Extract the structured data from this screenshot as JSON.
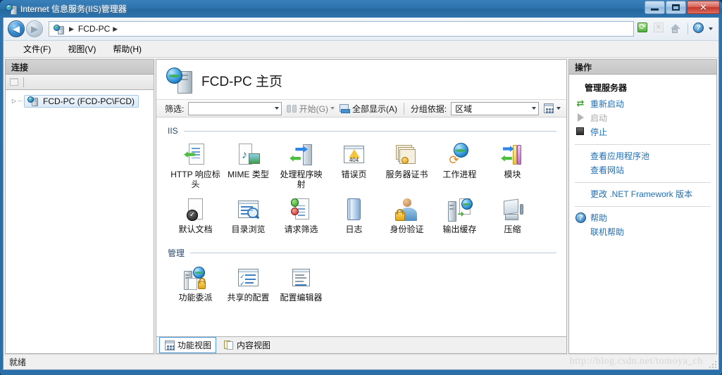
{
  "window": {
    "title": "Internet 信息服务(IIS)管理器",
    "buttons": {
      "minimize": "—",
      "maximize": "❐",
      "close": "✕"
    }
  },
  "nav": {
    "back_glyph": "◀",
    "forward_glyph": "▶",
    "breadcrumb": [
      "FCD-PC"
    ],
    "separator": "▶",
    "tools": [
      {
        "name": "refresh-icon",
        "tooltip": "刷新"
      },
      {
        "name": "stop-icon",
        "tooltip": "停止"
      },
      {
        "name": "home-icon",
        "tooltip": "主页"
      },
      {
        "name": "help-icon",
        "tooltip": "帮助"
      }
    ]
  },
  "menubar": {
    "items": [
      "文件(F)",
      "视图(V)",
      "帮助(H)"
    ]
  },
  "sidebar": {
    "title": "连接",
    "tree": [
      {
        "label": "FCD-PC (FCD-PC\\FCD)",
        "expander": "▷",
        "selected": true
      }
    ]
  },
  "main": {
    "page_title": "FCD-PC 主页",
    "filter": {
      "label": "筛选:",
      "value": "",
      "go_label": "开始(G)",
      "show_all_label": "全部显示(A)",
      "group_by_label": "分组依据:",
      "group_by_value": "区域"
    },
    "sections": [
      {
        "title": "IIS",
        "items": [
          {
            "label": "HTTP 响应标头",
            "icon": "http-response-headers-icon"
          },
          {
            "label": "MIME 类型",
            "icon": "mime-types-icon"
          },
          {
            "label": "处理程序映射",
            "icon": "handler-mappings-icon"
          },
          {
            "label": "错误页",
            "icon": "error-pages-icon"
          },
          {
            "label": "服务器证书",
            "icon": "server-certificates-icon"
          },
          {
            "label": "工作进程",
            "icon": "worker-processes-icon"
          },
          {
            "label": "模块",
            "icon": "modules-icon"
          },
          {
            "label": "默认文档",
            "icon": "default-document-icon"
          },
          {
            "label": "目录浏览",
            "icon": "directory-browsing-icon"
          },
          {
            "label": "请求筛选",
            "icon": "request-filtering-icon"
          },
          {
            "label": "日志",
            "icon": "logging-icon"
          },
          {
            "label": "身份验证",
            "icon": "authentication-icon"
          },
          {
            "label": "输出缓存",
            "icon": "output-caching-icon"
          },
          {
            "label": "压缩",
            "icon": "compression-icon"
          }
        ]
      },
      {
        "title": "管理",
        "items": [
          {
            "label": "功能委派",
            "icon": "feature-delegation-icon"
          },
          {
            "label": "共享的配置",
            "icon": "shared-configuration-icon"
          },
          {
            "label": "配置编辑器",
            "icon": "configuration-editor-icon"
          }
        ]
      }
    ],
    "view_tabs": [
      {
        "label": "功能视图",
        "selected": true
      },
      {
        "label": "内容视图",
        "selected": false
      }
    ]
  },
  "actions": {
    "title": "操作",
    "group_title": "管理服务器",
    "items": [
      {
        "label": "重新启动",
        "icon": "restart-icon",
        "disabled": false
      },
      {
        "label": "启动",
        "icon": "start-icon",
        "disabled": true
      },
      {
        "label": "停止",
        "icon": "stop-square-icon",
        "disabled": false
      }
    ],
    "links": [
      {
        "label": "查看应用程序池"
      },
      {
        "label": "查看网站"
      }
    ],
    "framework_link": "更改 .NET Framework 版本",
    "help": {
      "label": "帮助",
      "icon": "help-circle-icon"
    },
    "online_help": "联机帮助"
  },
  "statusbar": {
    "text": "就绪",
    "watermark": "http://blog.csdn.net/tomoya_ch"
  },
  "colors": {
    "titlebar": "#2c72ac",
    "link": "#1f6fb5",
    "section_title": "#2c4a6e",
    "accent": "#4a9be0"
  }
}
